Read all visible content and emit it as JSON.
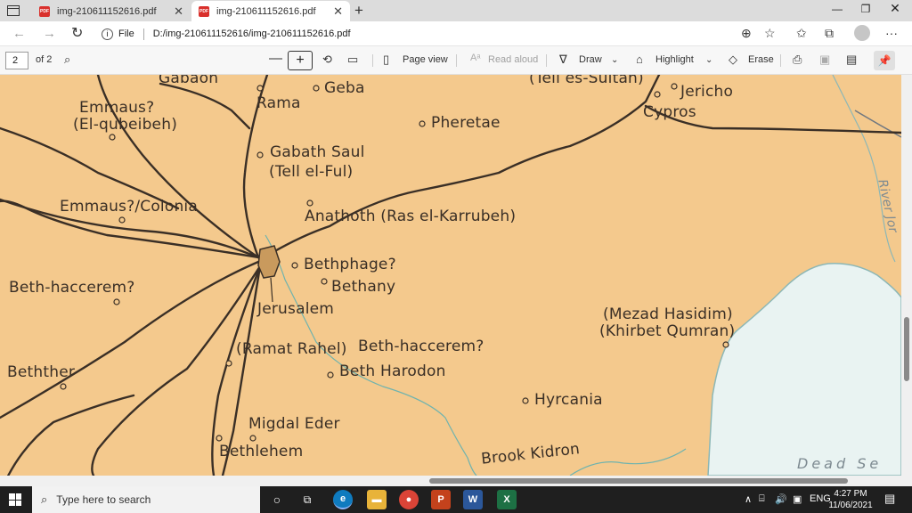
{
  "browser": {
    "tabs": [
      {
        "title": "img-210611152616.pdf",
        "active": false
      },
      {
        "title": "img-210611152616.pdf",
        "active": true
      }
    ],
    "address": {
      "scheme_label": "File",
      "url": "D:/img-210611152616/img-210611152616.pdf"
    }
  },
  "pdf_toolbar": {
    "page_current": "2",
    "page_total": "of 2",
    "page_view": "Page view",
    "read_aloud": "Read aloud",
    "draw": "Draw",
    "highlight": "Highlight",
    "erase": "Erase"
  },
  "map": {
    "places": [
      {
        "id": "gabaon",
        "text": "Gabaon"
      },
      {
        "id": "rama",
        "text": "Rama"
      },
      {
        "id": "geba",
        "text": "Geba"
      },
      {
        "id": "tell-es-sultan",
        "text": "(Tell es-Sultan)"
      },
      {
        "id": "jericho",
        "text": "Jericho"
      },
      {
        "id": "cypros",
        "text": "Cypros"
      },
      {
        "id": "emmaus-1",
        "text": "Emmaus?"
      },
      {
        "id": "el-qubeibeh",
        "text": "(El-qubeibeh)"
      },
      {
        "id": "pheretae",
        "text": "Pheretae"
      },
      {
        "id": "gabath-saul",
        "text": "Gabath Saul"
      },
      {
        "id": "tell-el-ful",
        "text": "(Tell el-Ful)"
      },
      {
        "id": "emmaus-colonia",
        "text": "Emmaus?/Colonia"
      },
      {
        "id": "anathoth",
        "text": "Anathoth (Ras el-Karrubeh)"
      },
      {
        "id": "bethphage",
        "text": "Bethphage?"
      },
      {
        "id": "bethany",
        "text": "Bethany"
      },
      {
        "id": "beth-haccerem-1",
        "text": "Beth-haccerem?"
      },
      {
        "id": "jerusalem",
        "text": "Jerusalem"
      },
      {
        "id": "mezad-hasidim",
        "text": "(Mezad Hasidim)"
      },
      {
        "id": "khirbet-qumran",
        "text": "(Khirbet Qumran)"
      },
      {
        "id": "ramat-rahel",
        "text": "(Ramat Rahel)"
      },
      {
        "id": "beth-haccerem-2",
        "text": "Beth-haccerem?"
      },
      {
        "id": "bethther",
        "text": "Bethther"
      },
      {
        "id": "beth-harodon",
        "text": "Beth Harodon"
      },
      {
        "id": "hyrcania",
        "text": "Hyrcania"
      },
      {
        "id": "migdal-eder",
        "text": "Migdal Eder"
      },
      {
        "id": "bethlehem",
        "text": "Bethlehem"
      },
      {
        "id": "brook-kidron",
        "text": "Brook Kidron"
      },
      {
        "id": "dead-sea",
        "text": "Dead Se"
      },
      {
        "id": "river-jordan",
        "text": "River Jor"
      }
    ]
  },
  "taskbar": {
    "search_placeholder": "Type here to search",
    "language": "ENG",
    "time": "4:27 PM",
    "date": "11/06/2021"
  }
}
